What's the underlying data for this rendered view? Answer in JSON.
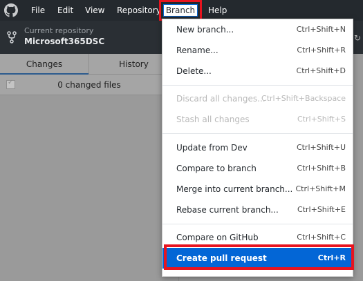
{
  "menubar": {
    "items": [
      "File",
      "Edit",
      "View",
      "Repository",
      "Branch",
      "Help"
    ]
  },
  "toolbar": {
    "repo_caption": "Current repository",
    "repo_name": "Microsoft365DSC"
  },
  "left_panel": {
    "tabs": [
      "Changes",
      "History"
    ],
    "changed_files": "0 changed files"
  },
  "branch_menu": {
    "groups": [
      [
        {
          "label": "New branch...",
          "shortcut": "Ctrl+Shift+N",
          "enabled": true
        },
        {
          "label": "Rename...",
          "shortcut": "Ctrl+Shift+R",
          "enabled": true
        },
        {
          "label": "Delete...",
          "shortcut": "Ctrl+Shift+D",
          "enabled": true
        }
      ],
      [
        {
          "label": "Discard all changes...",
          "shortcut": "Ctrl+Shift+Backspace",
          "enabled": false
        },
        {
          "label": "Stash all changes",
          "shortcut": "Ctrl+Shift+S",
          "enabled": false
        }
      ],
      [
        {
          "label": "Update from Dev",
          "shortcut": "Ctrl+Shift+U",
          "enabled": true
        },
        {
          "label": "Compare to branch",
          "shortcut": "Ctrl+Shift+B",
          "enabled": true
        },
        {
          "label": "Merge into current branch...",
          "shortcut": "Ctrl+Shift+M",
          "enabled": true
        },
        {
          "label": "Rebase current branch...",
          "shortcut": "Ctrl+Shift+E",
          "enabled": true
        }
      ],
      [
        {
          "label": "Compare on GitHub",
          "shortcut": "Ctrl+Shift+C",
          "enabled": true
        },
        {
          "label": "Create pull request",
          "shortcut": "Ctrl+R",
          "enabled": true,
          "highlighted": true
        }
      ]
    ]
  },
  "colors": {
    "menubar_bg": "#24292e",
    "highlight_blue": "#0366d6",
    "annotation_red": "#e8141f"
  }
}
